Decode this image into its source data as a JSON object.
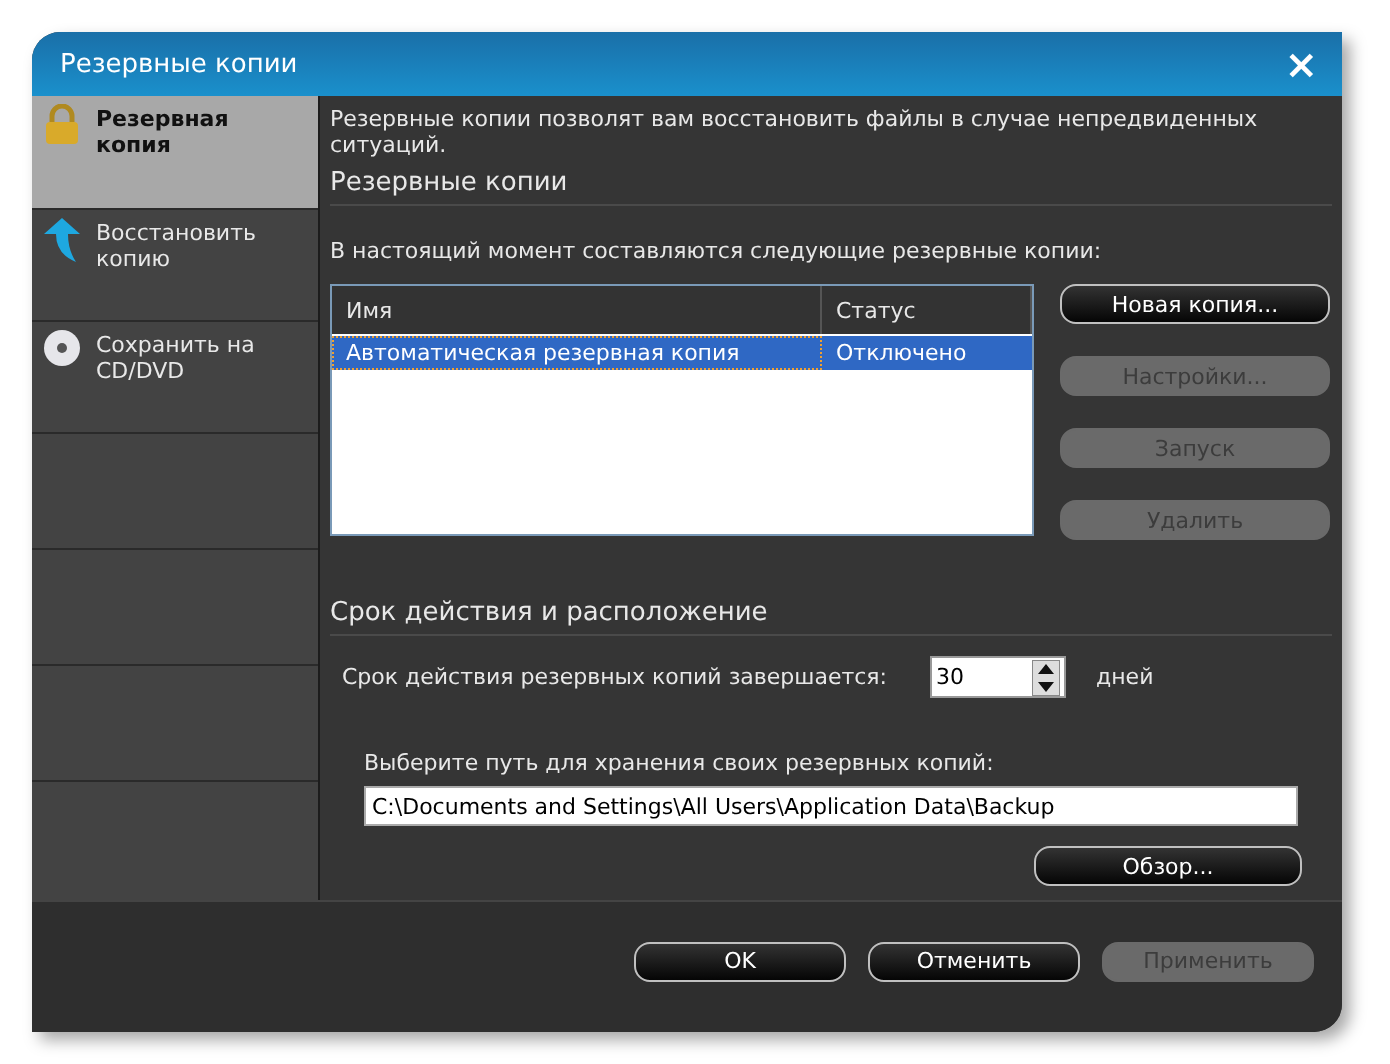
{
  "window": {
    "title": "Резервные копии",
    "close": "×"
  },
  "sidebar": {
    "items": [
      {
        "label": "Резервная копия",
        "kind": "lock",
        "selected": true
      },
      {
        "label": "Восстановить копию",
        "kind": "arrow",
        "selected": false
      },
      {
        "label": "Сохранить на CD/DVD",
        "kind": "disc",
        "selected": false
      }
    ]
  },
  "description": "Резервные копии позволят вам восстановить файлы в случае непредвиденных ситуаций.",
  "backups_section": {
    "heading": "Резервные копии",
    "intro": "В настоящий момент составляются следующие резервные копии:",
    "table": {
      "columns": [
        "Имя",
        "Статус"
      ],
      "rows": [
        {
          "cells": [
            "Автоматическая резервная копия",
            "Отключено"
          ],
          "selected": true
        }
      ]
    },
    "buttons": [
      {
        "label": "Новая копия...",
        "disabled": false
      },
      {
        "label": "Настройки...",
        "disabled": true
      },
      {
        "label": "Запуск",
        "disabled": true
      },
      {
        "label": "Удалить",
        "disabled": true
      }
    ]
  },
  "expiry_section": {
    "heading": "Срок действия и расположение",
    "expiry_label": "Срок действия резервных копий завершается:",
    "expiry_value": "30",
    "expiry_unit": "дней",
    "path_label": "Выберите путь для хранения своих резервных копий:",
    "path_value": "C:\\Documents and Settings\\All Users\\Application Data\\Backup",
    "browse": {
      "label": "Обзор...",
      "disabled": false
    }
  },
  "footer_buttons": [
    {
      "label": "OK",
      "disabled": false
    },
    {
      "label": "Отменить",
      "disabled": false
    },
    {
      "label": "Применить",
      "disabled": true
    }
  ]
}
